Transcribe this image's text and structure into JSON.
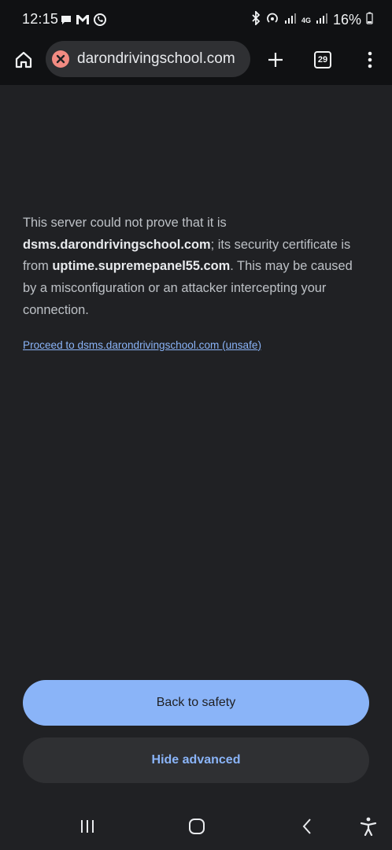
{
  "status_bar": {
    "time": "12:15",
    "battery": "16%",
    "network_label": "4G"
  },
  "toolbar": {
    "url": "darondrivingschool.com",
    "tab_count": "29"
  },
  "content": {
    "explanation_part1": "This server could not prove that it is ",
    "domain": "dsms.darondrivingschool.com",
    "explanation_part2": "; its security certificate is from ",
    "cert_domain": "uptime.supremepanel55.com",
    "explanation_part3": ". This may be caused by a misconfiguration or an attacker intercepting your connection.",
    "proceed_link": "Proceed to dsms.darondrivingschool.com (unsafe)"
  },
  "buttons": {
    "back_to_safety": "Back to safety",
    "hide_advanced": "Hide advanced"
  },
  "colors": {
    "accent": "#8ab4f8",
    "background": "#202124",
    "error": "#f28b82"
  }
}
